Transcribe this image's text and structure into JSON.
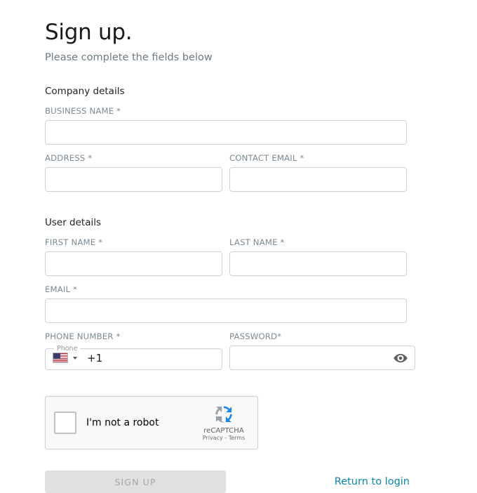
{
  "header": {
    "title": "Sign up.",
    "subtitle": "Please complete the fields below"
  },
  "sections": [
    {
      "heading": "Company details",
      "fields": [
        {
          "label": "BUSINESS NAME *",
          "value": "",
          "placeholder": ""
        },
        {
          "label": "ADDRESS *",
          "value": "",
          "placeholder": ""
        },
        {
          "label": "CONTACT EMAIL *",
          "value": "",
          "placeholder": ""
        }
      ]
    },
    {
      "heading": "User details",
      "fields": [
        {
          "label": "FIRST NAME *",
          "value": "",
          "placeholder": ""
        },
        {
          "label": "LAST NAME *",
          "value": "",
          "placeholder": ""
        },
        {
          "label": "EMAIL *",
          "value": "",
          "placeholder": ""
        },
        {
          "label": "PHONE NUMBER *",
          "value": "",
          "placeholder": ""
        },
        {
          "label": "PASSWORD*",
          "value": "",
          "placeholder": ""
        }
      ]
    }
  ],
  "phone": {
    "legend": "Phone",
    "country_flag": "us-flag-icon",
    "dial_code": "+1",
    "dropdown_icon": "chevron-down-icon",
    "value": ""
  },
  "password": {
    "toggle_icon": "eye-icon",
    "value": ""
  },
  "recaptcha": {
    "checkbox_label": "I'm not a robot",
    "brand": "reCAPTCHA",
    "links": "Privacy - Terms",
    "logo_icon": "recaptcha-logo-icon"
  },
  "footer": {
    "submit_label": "SIGN UP",
    "return_label": "Return to login"
  },
  "colors": {
    "link": "#0a87ae",
    "label": "#7b8a94",
    "subtitle": "#6b7a84",
    "border": "#ccd2d6",
    "button_disabled_bg": "#e0e0e0",
    "button_disabled_text": "#a6a6a6",
    "recaptcha_bg": "#f9f9f9",
    "flag_red": "#b22234",
    "flag_blue": "#3c3b6e"
  }
}
